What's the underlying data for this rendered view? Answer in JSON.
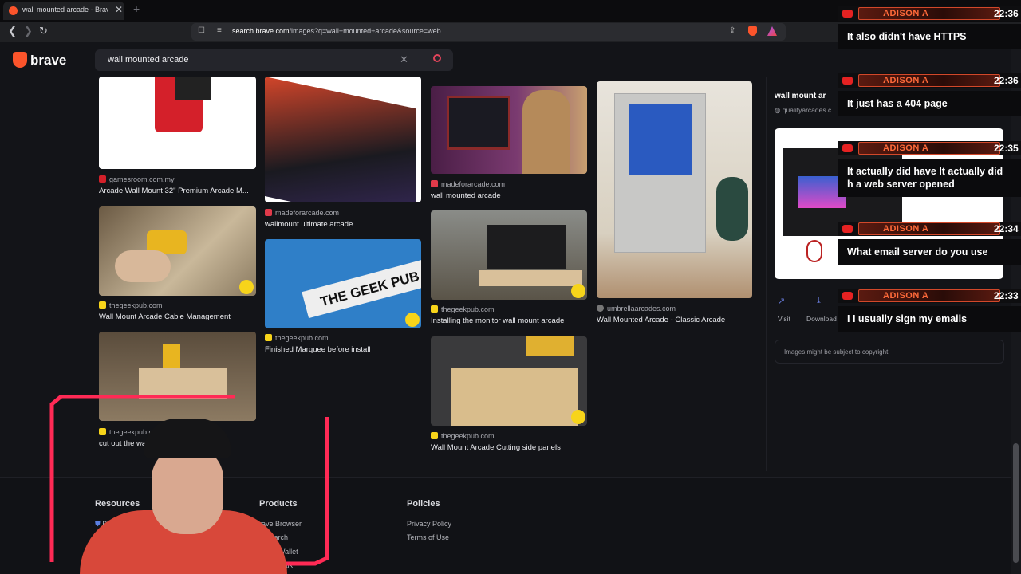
{
  "browser": {
    "tab_title": "wall mounted arcade - Brave Se",
    "url_host": "search.brave.com",
    "url_path": "/images?q=wall+mounted+arcade&source=web"
  },
  "brand": {
    "logo_text": "brave"
  },
  "search": {
    "query": "wall mounted arcade"
  },
  "results": [
    {
      "source": "gamesroom.com.my",
      "caption": "Arcade Wall Mount 32\" Premium Arcade M..."
    },
    {
      "source": "madeforarcade.com",
      "caption": "wallmount ultimate arcade"
    },
    {
      "source": "madeforarcade.com",
      "caption": "wall mounted arcade"
    },
    {
      "source": "umbrellaarcades.com",
      "caption": "Wall Mounted Arcade - Classic Arcade"
    },
    {
      "source": "thegeekpub.com",
      "caption": "Wall Mount Arcade Cable Management"
    },
    {
      "source": "thegeekpub.com",
      "caption": "Finished Marquee before install"
    },
    {
      "source": "thegeekpub.com",
      "caption": "Installing the monitor wall mount arcade"
    },
    {
      "source": "thegeekpub.c",
      "caption": "cut out the wall"
    },
    {
      "source": "thegeekpub.com",
      "caption": "Wall Mount Arcade Cutting side panels"
    }
  ],
  "marquee_text": "THE GEEK PUB",
  "side_panel": {
    "title": "wall mount ar",
    "source": "qualityarcades.c",
    "actions": [
      "Visit",
      "Download"
    ],
    "copyright": "Images might be subject to copyright"
  },
  "footer": {
    "resources": {
      "heading": "Resources",
      "links": [
        "Brave",
        "Br"
      ]
    },
    "products": {
      "heading": "Products",
      "links": [
        "rave Browser",
        "e Search",
        "Wallet",
        "Talk"
      ]
    },
    "policies": {
      "heading": "Policies",
      "links": [
        "Privacy Policy",
        "Terms of Use"
      ]
    }
  },
  "chat": [
    {
      "name": "ADISON A",
      "time": "22:36",
      "text": "It also didn't have HTTPS"
    },
    {
      "name": "ADISON A",
      "time": "22:36",
      "text": "It just has a 404 page"
    },
    {
      "name": "ADISON A",
      "time": "22:35",
      "text": "It actually did have It actually did h a web server opened"
    },
    {
      "name": "ADISON A",
      "time": "22:34",
      "text": "What email server do you use"
    },
    {
      "name": "ADISON A",
      "time": "22:33",
      "text": "I I usually sign my emails"
    }
  ],
  "colors": {
    "accent": "#fb542b",
    "chat_name": "#ff6a3a",
    "page_bg": "#131418"
  }
}
